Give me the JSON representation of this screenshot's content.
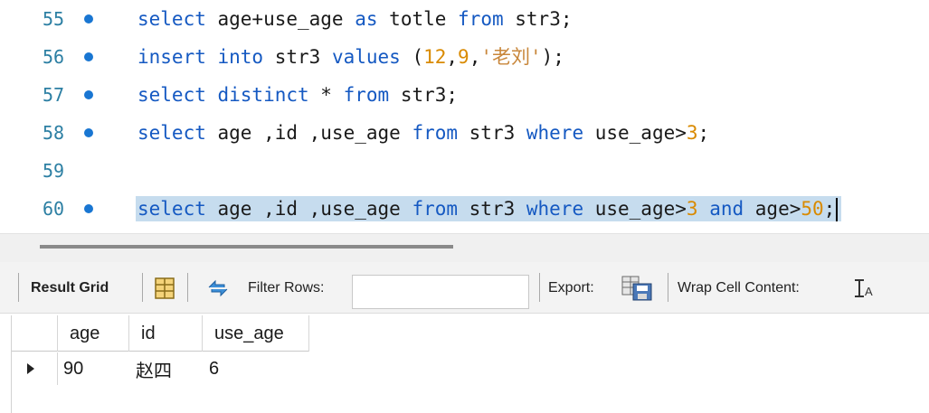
{
  "editor": {
    "lines": [
      {
        "number": "55",
        "breakpoint": true,
        "selected": false,
        "tokens": [
          {
            "t": "kw",
            "v": "select"
          },
          {
            "t": "txt",
            "v": " age+use_age "
          },
          {
            "t": "kw",
            "v": "as"
          },
          {
            "t": "txt",
            "v": " totle "
          },
          {
            "t": "kw",
            "v": "from"
          },
          {
            "t": "txt",
            "v": " str3;"
          }
        ]
      },
      {
        "number": "56",
        "breakpoint": true,
        "selected": false,
        "tokens": [
          {
            "t": "kw",
            "v": "insert into"
          },
          {
            "t": "txt",
            "v": " str3 "
          },
          {
            "t": "kw",
            "v": "values"
          },
          {
            "t": "txt",
            "v": " ("
          },
          {
            "t": "num",
            "v": "12"
          },
          {
            "t": "txt",
            "v": ","
          },
          {
            "t": "num",
            "v": "9"
          },
          {
            "t": "txt",
            "v": ","
          },
          {
            "t": "str",
            "v": "'老刘'"
          },
          {
            "t": "txt",
            "v": ");"
          }
        ]
      },
      {
        "number": "57",
        "breakpoint": true,
        "selected": false,
        "tokens": [
          {
            "t": "kw",
            "v": "select distinct"
          },
          {
            "t": "txt",
            "v": " * "
          },
          {
            "t": "kw",
            "v": "from"
          },
          {
            "t": "txt",
            "v": " str3;"
          }
        ]
      },
      {
        "number": "58",
        "breakpoint": true,
        "selected": false,
        "tokens": [
          {
            "t": "kw",
            "v": "select"
          },
          {
            "t": "txt",
            "v": " age ,id ,use_age "
          },
          {
            "t": "kw",
            "v": "from"
          },
          {
            "t": "txt",
            "v": " str3 "
          },
          {
            "t": "kw",
            "v": "where"
          },
          {
            "t": "txt",
            "v": " use_age>"
          },
          {
            "t": "num",
            "v": "3"
          },
          {
            "t": "txt",
            "v": ";"
          }
        ]
      },
      {
        "number": "59",
        "breakpoint": false,
        "selected": false,
        "tokens": []
      },
      {
        "number": "60",
        "breakpoint": true,
        "selected": true,
        "tokens": [
          {
            "t": "kw",
            "v": "select"
          },
          {
            "t": "txt",
            "v": " age ,id ,use_age "
          },
          {
            "t": "kw",
            "v": "from"
          },
          {
            "t": "txt",
            "v": " str3 "
          },
          {
            "t": "kw",
            "v": "where"
          },
          {
            "t": "txt",
            "v": " use_age>"
          },
          {
            "t": "num",
            "v": "3"
          },
          {
            "t": "txt",
            "v": " "
          },
          {
            "t": "kw",
            "v": "and"
          },
          {
            "t": "txt",
            "v": " age>"
          },
          {
            "t": "num",
            "v": "50"
          },
          {
            "t": "txt",
            "v": ";"
          }
        ]
      }
    ]
  },
  "toolbar": {
    "result_grid_label": "Result Grid",
    "grid_icon": "grid-layout-icon",
    "refresh_icon": "refresh-icon",
    "filter_rows_label": "Filter Rows:",
    "filter_rows_value": "",
    "export_label": "Export:",
    "export_icon": "export-save-icon",
    "wrap_cell_label": "Wrap Cell Content:",
    "wrap_icon": "wrap-text-icon"
  },
  "result_grid": {
    "columns": [
      "age",
      "id",
      "use_age"
    ],
    "rows": [
      [
        "90",
        "赵四",
        "6"
      ]
    ]
  },
  "colors": {
    "keyword": "#1559c2",
    "number": "#d98a00",
    "string": "#c8863a",
    "line_number": "#2c7fa3",
    "breakpoint": "#1976d2",
    "selection": "#c6dcee"
  }
}
